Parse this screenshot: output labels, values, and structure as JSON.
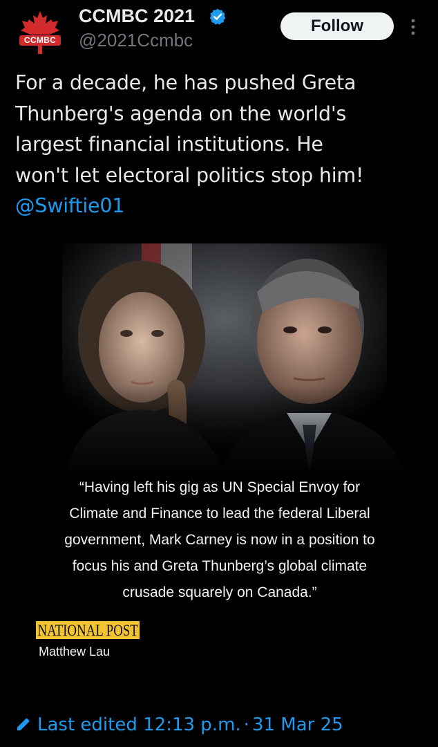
{
  "account": {
    "display_name": "CCMBC 2021",
    "handle": "@2021Ccmbc",
    "avatar_text": "CCMBC",
    "verified": true
  },
  "actions": {
    "follow_label": "Follow",
    "more_icon": "more-vertical-icon"
  },
  "tweet": {
    "text_lines": [
      "For a decade, he has pushed Greta",
      "Thunberg's agenda on the world's",
      "largest financial institutions. He",
      "won't let electoral politics stop him!"
    ],
    "mention": "@Swiftie01"
  },
  "media": {
    "quote_lines": [
      "“Having left his gig as UN Special Envoy for",
      "Climate and Finance to lead the federal Liberal",
      "government, Mark Carney is now in a position to",
      "focus his and Greta Thunberg’s global climate",
      "crusade squarely on Canada.”"
    ],
    "publication": "NATIONAL POST",
    "author": "Matthew Lau"
  },
  "edited": {
    "label": "Last edited",
    "time": "12:13 p.m.",
    "separator": "·",
    "date": "31 Mar 25",
    "icon": "pencil-icon"
  },
  "colors": {
    "background": "#000000",
    "text": "#e7e9ea",
    "muted": "#71767b",
    "link": "#1d9bf0",
    "verified": "#1d9bf0",
    "follow_bg": "#eff3f4",
    "avatar_red": "#d32b2b",
    "np_yellow": "#f1c232"
  }
}
